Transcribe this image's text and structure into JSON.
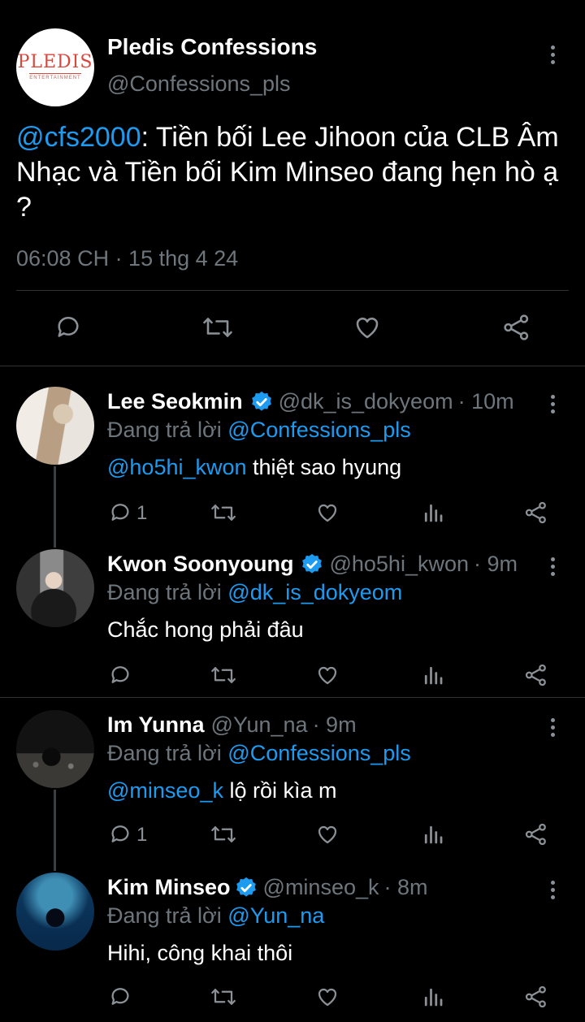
{
  "main_tweet": {
    "account_name": "Pledis Confessions",
    "handle": "@Confessions_pls",
    "avatar_logo": "PLEDIS",
    "avatar_logo_sub": "ENTERTAINMENT",
    "mention": "@cfs2000",
    "text": ": Tiền bối Lee Jihoon của CLB Âm Nhạc và Tiền bối Kim Minseo đang hẹn hò ạ ?",
    "timestamp": "06:08 CH · 15 thg 4 24",
    "actions": [
      "reply-icon",
      "retweet-icon",
      "like-icon",
      "share-icon"
    ]
  },
  "replies": [
    {
      "name": "Lee Seokmin",
      "verified": true,
      "handle": "@dk_is_dokyeom",
      "time": "· 10m",
      "replying_label": "Đang trả lời",
      "replying_to": "@Confessions_pls",
      "mention": "@ho5hi_kwon",
      "text": " thiệt sao hyung",
      "reply_count": "1"
    },
    {
      "name": "Kwon Soonyoung",
      "verified": true,
      "handle": "@ho5hi_kwon",
      "time": "· 9m",
      "replying_label": "Đang trả lời",
      "replying_to": "@dk_is_dokyeom",
      "mention": "",
      "text": "Chắc hong phải đâu",
      "reply_count": ""
    },
    {
      "name": "Im Yunna",
      "verified": false,
      "handle": "@Yun_na",
      "time": "· 9m",
      "replying_label": "Đang trả lời",
      "replying_to": "@Confessions_pls",
      "mention": "@minseo_k",
      "text": " lộ rồi kìa m",
      "reply_count": "1"
    },
    {
      "name": "Kim Minseo",
      "verified": true,
      "handle": "@minseo_k",
      "time": "· 8m",
      "replying_label": "Đang trả lời",
      "replying_to": "@Yun_na",
      "mention": "",
      "text": "Hihi, công khai thôi",
      "reply_count": ""
    }
  ],
  "reply_action_icons": [
    "reply-icon",
    "retweet-icon",
    "like-icon",
    "views-icon",
    "share-icon"
  ],
  "colors": {
    "background": "#000000",
    "link": "#1d9bf0",
    "secondary": "#6e767d",
    "verified": "#1d9bf0"
  }
}
